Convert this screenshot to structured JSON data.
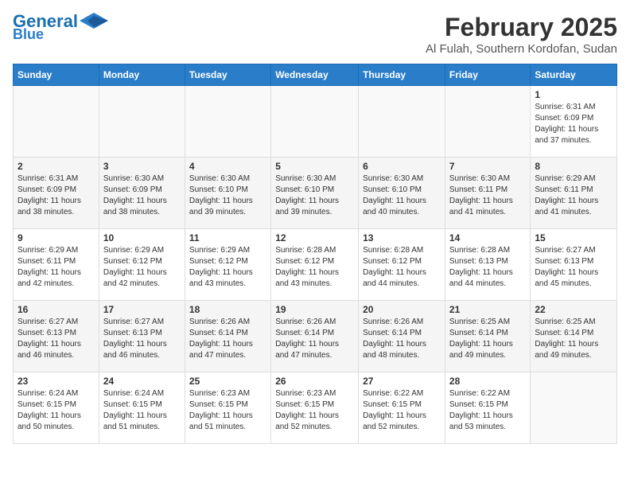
{
  "logo": {
    "line1": "General",
    "line2": "Blue"
  },
  "title": "February 2025",
  "subtitle": "Al Fulah, Southern Kordofan, Sudan",
  "days_of_week": [
    "Sunday",
    "Monday",
    "Tuesday",
    "Wednesday",
    "Thursday",
    "Friday",
    "Saturday"
  ],
  "weeks": [
    [
      {
        "day": "",
        "info": ""
      },
      {
        "day": "",
        "info": ""
      },
      {
        "day": "",
        "info": ""
      },
      {
        "day": "",
        "info": ""
      },
      {
        "day": "",
        "info": ""
      },
      {
        "day": "",
        "info": ""
      },
      {
        "day": "1",
        "info": "Sunrise: 6:31 AM\nSunset: 6:09 PM\nDaylight: 11 hours\nand 37 minutes."
      }
    ],
    [
      {
        "day": "2",
        "info": "Sunrise: 6:31 AM\nSunset: 6:09 PM\nDaylight: 11 hours\nand 38 minutes."
      },
      {
        "day": "3",
        "info": "Sunrise: 6:30 AM\nSunset: 6:09 PM\nDaylight: 11 hours\nand 38 minutes."
      },
      {
        "day": "4",
        "info": "Sunrise: 6:30 AM\nSunset: 6:10 PM\nDaylight: 11 hours\nand 39 minutes."
      },
      {
        "day": "5",
        "info": "Sunrise: 6:30 AM\nSunset: 6:10 PM\nDaylight: 11 hours\nand 39 minutes."
      },
      {
        "day": "6",
        "info": "Sunrise: 6:30 AM\nSunset: 6:10 PM\nDaylight: 11 hours\nand 40 minutes."
      },
      {
        "day": "7",
        "info": "Sunrise: 6:30 AM\nSunset: 6:11 PM\nDaylight: 11 hours\nand 41 minutes."
      },
      {
        "day": "8",
        "info": "Sunrise: 6:29 AM\nSunset: 6:11 PM\nDaylight: 11 hours\nand 41 minutes."
      }
    ],
    [
      {
        "day": "9",
        "info": "Sunrise: 6:29 AM\nSunset: 6:11 PM\nDaylight: 11 hours\nand 42 minutes."
      },
      {
        "day": "10",
        "info": "Sunrise: 6:29 AM\nSunset: 6:12 PM\nDaylight: 11 hours\nand 42 minutes."
      },
      {
        "day": "11",
        "info": "Sunrise: 6:29 AM\nSunset: 6:12 PM\nDaylight: 11 hours\nand 43 minutes."
      },
      {
        "day": "12",
        "info": "Sunrise: 6:28 AM\nSunset: 6:12 PM\nDaylight: 11 hours\nand 43 minutes."
      },
      {
        "day": "13",
        "info": "Sunrise: 6:28 AM\nSunset: 6:12 PM\nDaylight: 11 hours\nand 44 minutes."
      },
      {
        "day": "14",
        "info": "Sunrise: 6:28 AM\nSunset: 6:13 PM\nDaylight: 11 hours\nand 44 minutes."
      },
      {
        "day": "15",
        "info": "Sunrise: 6:27 AM\nSunset: 6:13 PM\nDaylight: 11 hours\nand 45 minutes."
      }
    ],
    [
      {
        "day": "16",
        "info": "Sunrise: 6:27 AM\nSunset: 6:13 PM\nDaylight: 11 hours\nand 46 minutes."
      },
      {
        "day": "17",
        "info": "Sunrise: 6:27 AM\nSunset: 6:13 PM\nDaylight: 11 hours\nand 46 minutes."
      },
      {
        "day": "18",
        "info": "Sunrise: 6:26 AM\nSunset: 6:14 PM\nDaylight: 11 hours\nand 47 minutes."
      },
      {
        "day": "19",
        "info": "Sunrise: 6:26 AM\nSunset: 6:14 PM\nDaylight: 11 hours\nand 47 minutes."
      },
      {
        "day": "20",
        "info": "Sunrise: 6:26 AM\nSunset: 6:14 PM\nDaylight: 11 hours\nand 48 minutes."
      },
      {
        "day": "21",
        "info": "Sunrise: 6:25 AM\nSunset: 6:14 PM\nDaylight: 11 hours\nand 49 minutes."
      },
      {
        "day": "22",
        "info": "Sunrise: 6:25 AM\nSunset: 6:14 PM\nDaylight: 11 hours\nand 49 minutes."
      }
    ],
    [
      {
        "day": "23",
        "info": "Sunrise: 6:24 AM\nSunset: 6:15 PM\nDaylight: 11 hours\nand 50 minutes."
      },
      {
        "day": "24",
        "info": "Sunrise: 6:24 AM\nSunset: 6:15 PM\nDaylight: 11 hours\nand 51 minutes."
      },
      {
        "day": "25",
        "info": "Sunrise: 6:23 AM\nSunset: 6:15 PM\nDaylight: 11 hours\nand 51 minutes."
      },
      {
        "day": "26",
        "info": "Sunrise: 6:23 AM\nSunset: 6:15 PM\nDaylight: 11 hours\nand 52 minutes."
      },
      {
        "day": "27",
        "info": "Sunrise: 6:22 AM\nSunset: 6:15 PM\nDaylight: 11 hours\nand 52 minutes."
      },
      {
        "day": "28",
        "info": "Sunrise: 6:22 AM\nSunset: 6:15 PM\nDaylight: 11 hours\nand 53 minutes."
      },
      {
        "day": "",
        "info": ""
      }
    ]
  ]
}
